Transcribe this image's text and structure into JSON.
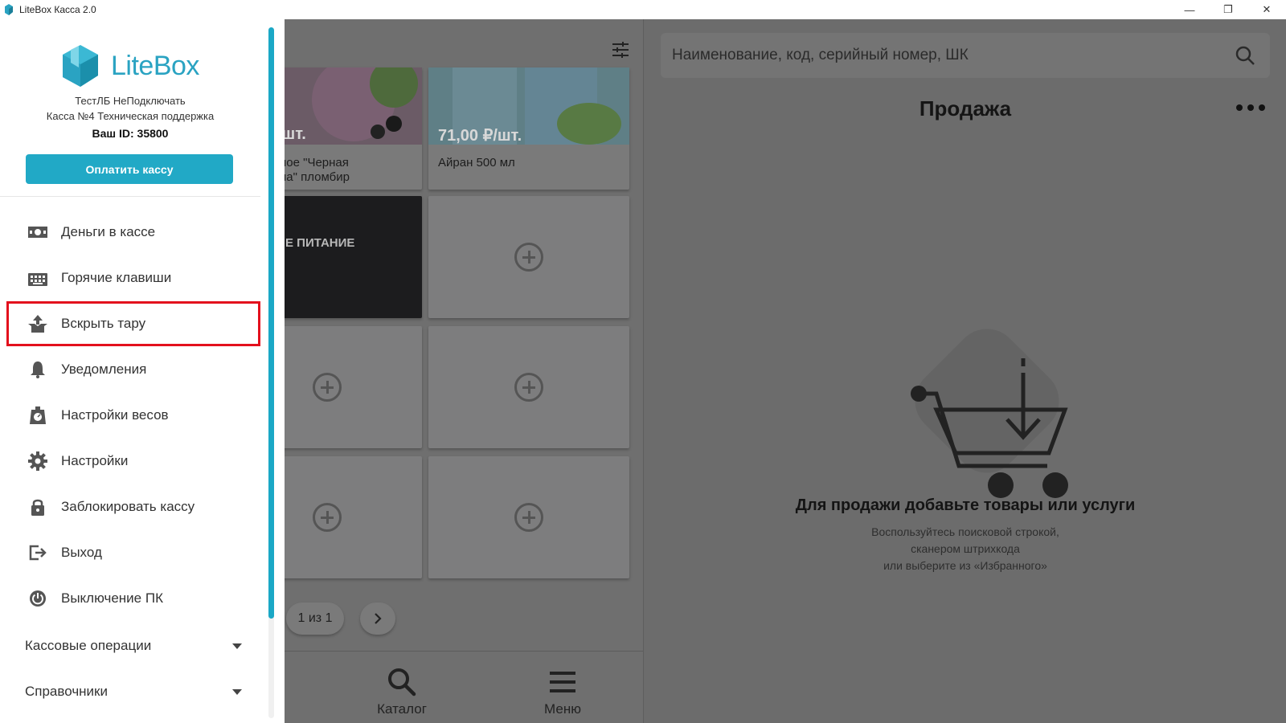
{
  "window": {
    "title": "LiteBox Касса 2.0",
    "controls": {
      "minimize": "—",
      "maximize": "❐",
      "close": "✕"
    }
  },
  "sidebar": {
    "logo_text": "LiteBox",
    "org_name": "ТестЛБ НеПодключать",
    "cash_register": "Касса №4 Техническая поддержка",
    "user_id": "Ваш ID: 35800",
    "pay_button": "Оплатить кассу",
    "items": [
      {
        "label": "Деньги в кассе",
        "icon": "cash-icon"
      },
      {
        "label": "Горячие клавиши",
        "icon": "keyboard-icon"
      },
      {
        "label": "Вскрыть тару",
        "icon": "open-box-icon",
        "highlighted": true
      },
      {
        "label": "Уведомления",
        "icon": "bell-icon"
      },
      {
        "label": "Настройки весов",
        "icon": "scale-icon"
      },
      {
        "label": "Настройки",
        "icon": "gear-icon"
      },
      {
        "label": "Заблокировать кассу",
        "icon": "lock-icon"
      },
      {
        "label": "Выход",
        "icon": "logout-icon"
      },
      {
        "label": "Выключение ПК",
        "icon": "power-icon"
      }
    ],
    "sections": [
      {
        "label": "Кассовые операции"
      },
      {
        "label": "Справочники"
      }
    ]
  },
  "catalog": {
    "products": [
      {
        "price": "/шт.",
        "name_line1": "ное \"Черная",
        "name_line2": "на\" пломбир"
      },
      {
        "price": "71,00 ₽/шт.",
        "name_line1": "Айран 500 мл",
        "name_line2": ""
      }
    ],
    "category": {
      "name": "Е ПИТАНИЕ"
    },
    "pager": {
      "label": "1 из 1"
    }
  },
  "bottom_nav": {
    "catalog": "Каталог",
    "menu": "Меню"
  },
  "sale": {
    "search_placeholder": "Наименование, код, серийный номер, ШК",
    "title": "Продажа",
    "empty_title": "Для продажи добавьте товары или услуги",
    "empty_line1": "Воспользуйтесь поисковой строкой,",
    "empty_line2": "сканером штрихкода",
    "empty_line3": "или выберите из «Избранного»"
  },
  "colors": {
    "accent": "#21a9c6",
    "highlight_border": "#e3101d",
    "overlay": "#6c6c6c"
  }
}
